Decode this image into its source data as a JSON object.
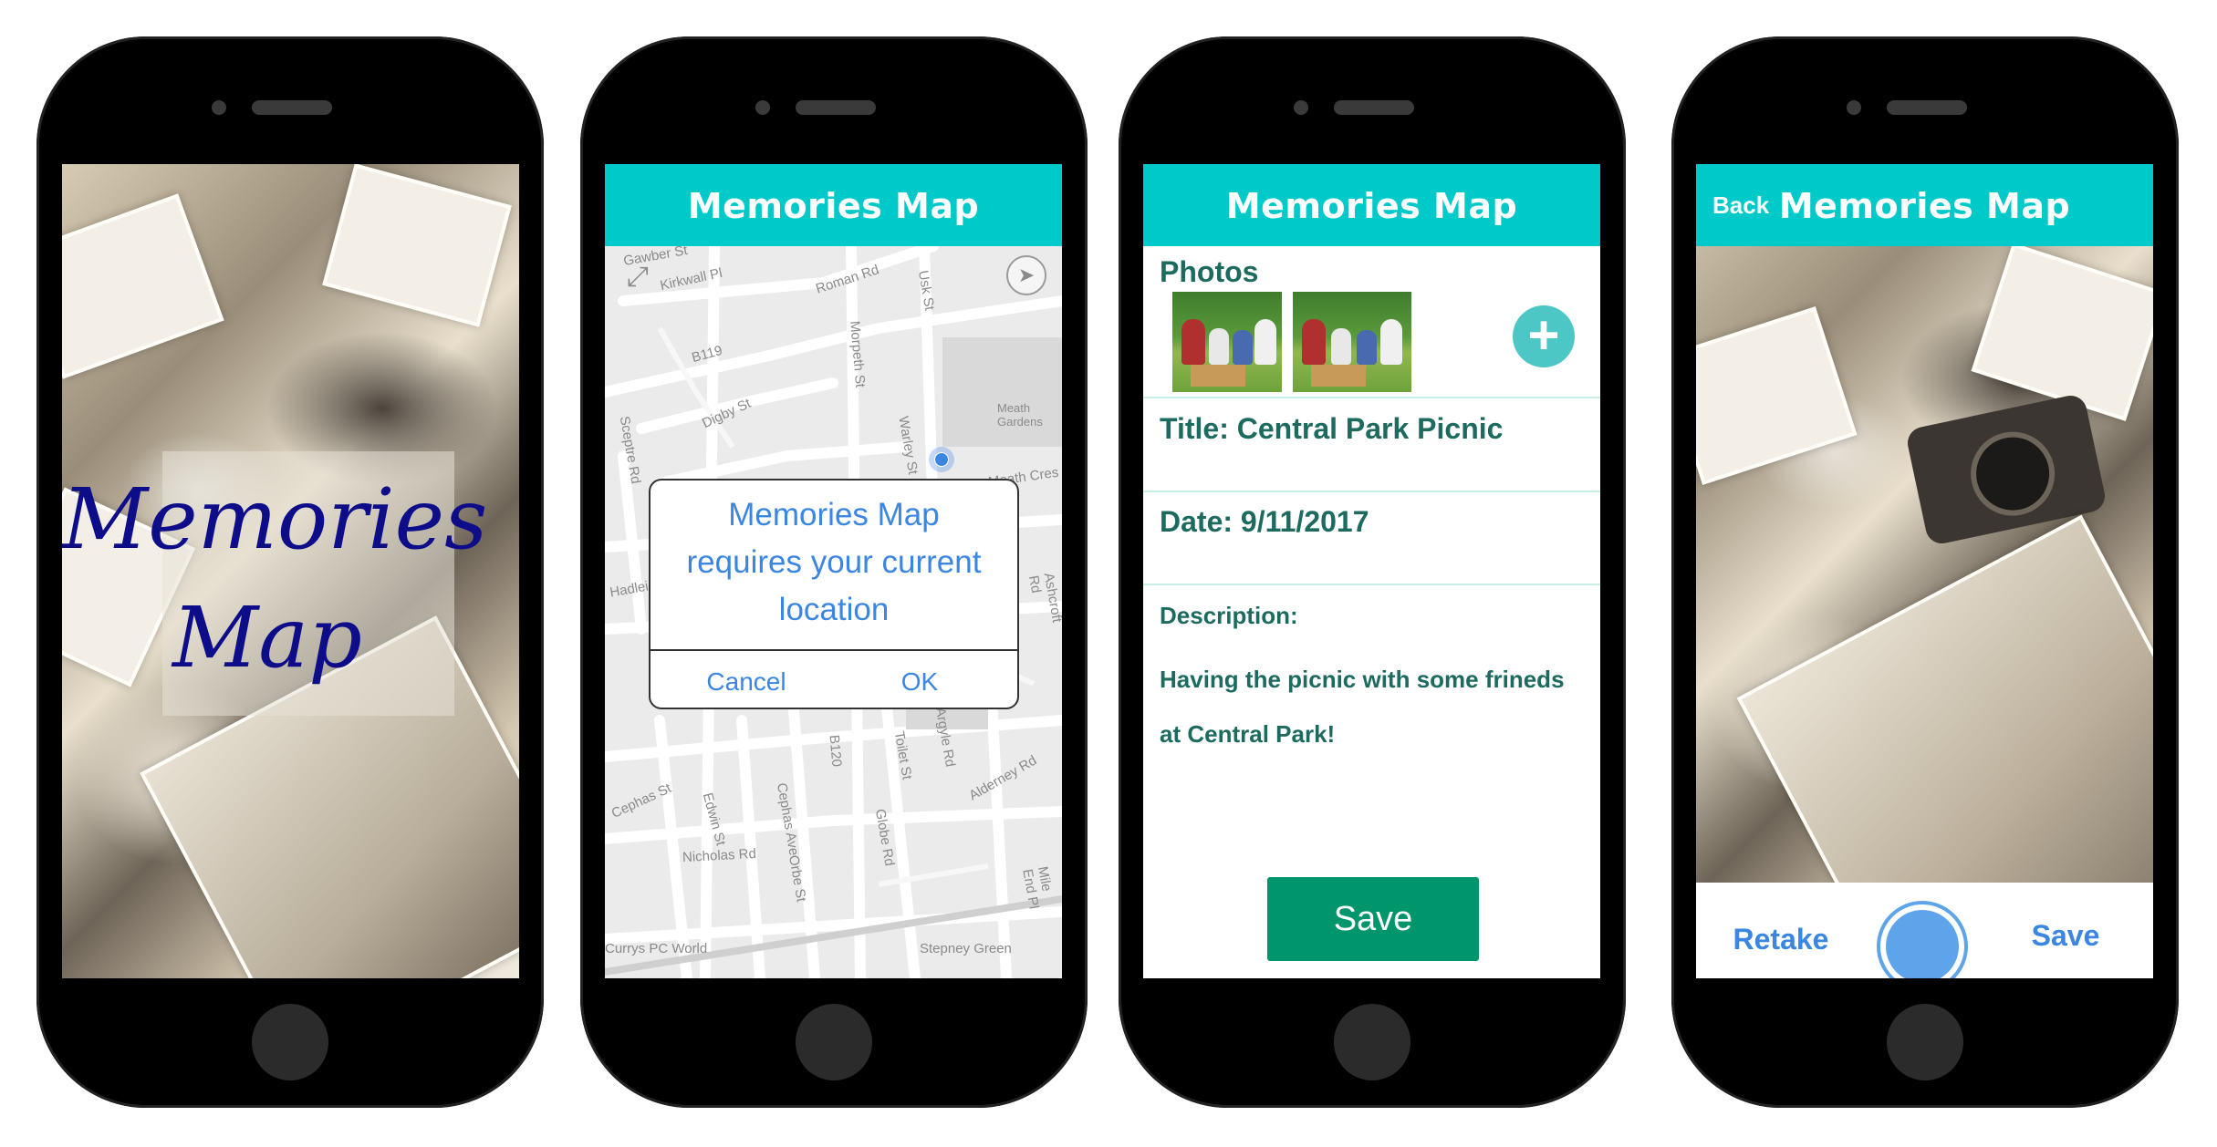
{
  "app": {
    "title": "Memories Map"
  },
  "splash": {
    "line1": "Memories",
    "line2": "Map"
  },
  "map_screen": {
    "header_title": "Memories Map",
    "streets": [
      "Gawber St",
      "Kirkwall Pl",
      "Roman Rd",
      "Usk St",
      "B119",
      "Morpeth St",
      "Digby St",
      "Meath Gardens",
      "Sceptre Rd",
      "Warley St",
      "Meath Cres",
      "Hadleigh St",
      "Cephas St",
      "Edwin St",
      "Cephas Ave",
      "Nicholas Rd",
      "Orbe St",
      "Ashcroft Rd",
      "B120",
      "Globe Rd",
      "Toilet St",
      "Argyle Rd",
      "Alderney Rd",
      "Mile End Pl",
      "Stepney Green",
      "Currys PC World"
    ],
    "dialog": {
      "message": "Memories Map requires your current location",
      "cancel": "Cancel",
      "ok": "OK"
    }
  },
  "detail_screen": {
    "header_title": "Memories Map",
    "photos_label": "Photos",
    "title_text": "Title: Central Park Picnic",
    "date_text": "Date: 9/11/2017",
    "description_label": "Description:",
    "description_line1": "Having the picnic with some frineds",
    "description_line2": "at Central Park!",
    "save_label": "Save"
  },
  "camera_screen": {
    "header_title": "Memories Map",
    "back_label": "Back",
    "retake_label": "Retake",
    "save_label": "Save"
  },
  "colors": {
    "header": "#00c9c9",
    "accent_green": "#00956a",
    "link_blue": "#3a86e0",
    "title_green": "#1c6b5e"
  }
}
